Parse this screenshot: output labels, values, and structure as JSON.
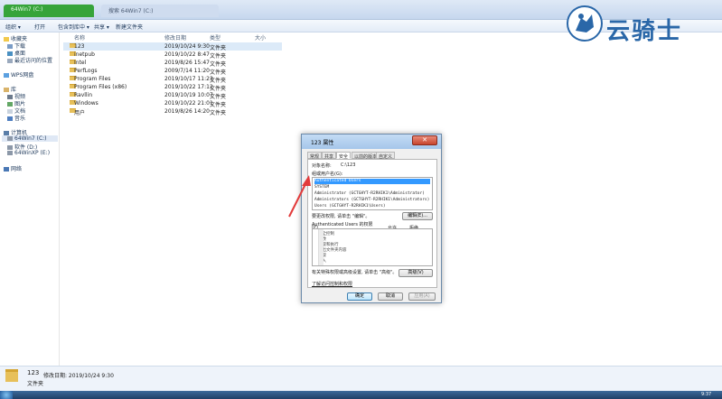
{
  "window": {
    "tab_active": "64Win7 (C:)",
    "tab_inactive": "搜索 64Win7 (C:)"
  },
  "toolbar": {
    "organize": "组织 ▾",
    "open": "打开",
    "include_in_library": "包含到库中 ▾",
    "share": "共享 ▾",
    "new_folder": "新建文件夹"
  },
  "sidebar": {
    "favorites": "收藏夹",
    "downloads": "下载",
    "desktop": "桌面",
    "recent": "最近访问的位置",
    "wps": "WPS网盘",
    "libraries": "库",
    "videos": "视频",
    "pictures": "图片",
    "documents": "文档",
    "music": "音乐",
    "computer": "计算机",
    "drive_c": "64Win7 (C:)",
    "drive_d": "软件 (D:)",
    "drive_e": "64WinXP (E:)",
    "network": "网络"
  },
  "columns": {
    "name": "名称",
    "modified": "修改日期",
    "type": "类型",
    "size": "大小"
  },
  "files": [
    {
      "name": "123",
      "date": "2019/10/24 9:30",
      "type": "文件夹"
    },
    {
      "name": "inetpub",
      "date": "2019/10/22 8:47",
      "type": "文件夹"
    },
    {
      "name": "Intel",
      "date": "2019/8/26 15:47",
      "type": "文件夹"
    },
    {
      "name": "PerfLogs",
      "date": "2009/7/14 11:20",
      "type": "文件夹"
    },
    {
      "name": "Program Files",
      "date": "2019/10/17 11:23",
      "type": "文件夹"
    },
    {
      "name": "Program Files (x86)",
      "date": "2019/10/22 17:12",
      "type": "文件夹"
    },
    {
      "name": "Ravllin",
      "date": "2019/10/19 10:07",
      "type": "文件夹"
    },
    {
      "name": "Windows",
      "date": "2019/10/22 21:01",
      "type": "文件夹"
    },
    {
      "name": "用户",
      "date": "2019/8/26 14:20",
      "type": "文件夹"
    }
  ],
  "details": {
    "name": "123",
    "modified": "修改日期: 2019/10/24 9:30",
    "type": "文件夹"
  },
  "taskbar": {
    "time": "9:37"
  },
  "logo": {
    "text": "云骑士"
  },
  "dialog": {
    "title": "123 属性",
    "close": "✕",
    "tabs": [
      "常规",
      "共享",
      "安全",
      "以前的版本",
      "自定义"
    ],
    "object_label": "对象名称:",
    "object_value": "C:\\123",
    "group_label": "组或用户名(G):",
    "users": [
      "Authenticated Users",
      "SYSTEM",
      "Administrator (GCTGHYT-R2RHIK1\\Administrator)",
      "Administrators (GCTGHYT-R2RHIK1\\Administrators)",
      "Users (GCTGHYT-R2RHIK1\\Users)"
    ],
    "change_hint": "要更改权限, 请单击 \"编辑\"。",
    "edit_button": "编辑(E)...",
    "perm_for": "Authenticated Users 的权限",
    "perm_col": "(P)",
    "allow": "允许",
    "deny": "拒绝",
    "permissions": [
      "完全控制",
      "修改",
      "读取和执行",
      "列出文件夹内容",
      "读取",
      "写入"
    ],
    "special_hint": "有关特殊权限或高级设置, 请单击 \"高级\"。",
    "advanced_button": "高级(V)",
    "learn_link": "了解访问控制和权限",
    "ok": "确定",
    "cancel": "取消",
    "apply": "应用(A)"
  }
}
